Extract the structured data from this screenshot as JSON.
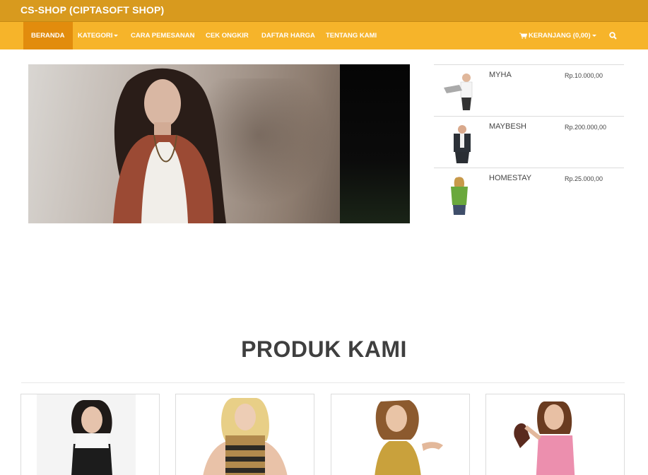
{
  "header": {
    "brand": "CS-SHOP (CIPTASOFT SHOP)"
  },
  "nav": {
    "items": [
      {
        "label": "BERANDA",
        "active": true
      },
      {
        "label": "KATEGORI",
        "dropdown": true
      },
      {
        "label": "CARA PEMESANAN"
      },
      {
        "label": "CEK ONGKIR"
      },
      {
        "label": "DAFTAR HARGA"
      },
      {
        "label": "TENTANG KAMI"
      }
    ],
    "cart_label": "KERANJANG (0,00)",
    "cart_icon": "cart-icon",
    "search_icon": "search-icon"
  },
  "side_products": [
    {
      "name": "MYHA",
      "price": "Rp.10.000,00"
    },
    {
      "name": "MAYBESH",
      "price": "Rp.200.000,00"
    },
    {
      "name": "HOMESTAY",
      "price": "Rp.25.000,00"
    }
  ],
  "section": {
    "title": "PRODUK KAMI"
  },
  "colors": {
    "brand_bar": "#d89a1e",
    "nav_bar": "#f6b42a",
    "nav_active": "#e28c0d"
  }
}
